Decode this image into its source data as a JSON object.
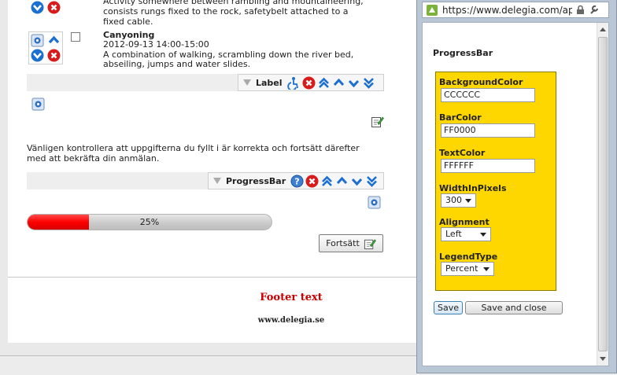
{
  "activities": [
    {
      "title": "",
      "lines": [
        "Activity somewhere between rambling and mountaineering,",
        "consists rungs fixed to the rock, safetybelt attached to a",
        "fixed cable."
      ]
    },
    {
      "title": "Canyoning",
      "lines": [
        "2012-09-13  14:00-15:00",
        "A combination of walking, scrambling down the river bed,",
        "abseiling, jumps and water slides."
      ]
    }
  ],
  "toolbars": {
    "label_toolbar": {
      "label": "Label"
    },
    "progressbar_toolbar": {
      "label": "ProgressBar"
    }
  },
  "instruction": {
    "line1": "Vänligen kontrollera att uppgifterna du fyllt i är korrekta och fortsätt därefter",
    "line2": "med att bekräfta din anmälan."
  },
  "progress": {
    "value_percent": 25,
    "text": "25%"
  },
  "continue_button": {
    "label": "Fortsätt"
  },
  "footer": {
    "text": "Footer text",
    "url": "www.delegia.se"
  },
  "popup": {
    "url": "https://www.delegia.com/app/a",
    "title": "ProgressBar",
    "fields": {
      "background_color": {
        "label": "BackgroundColor",
        "value": "CCCCCC"
      },
      "bar_color": {
        "label": "BarColor",
        "value": "FF0000"
      },
      "text_color": {
        "label": "TextColor",
        "value": "FFFFFF"
      },
      "width_in_pixels": {
        "label": "WidthInPixels",
        "value": "300"
      },
      "alignment": {
        "label": "Alignment",
        "value": "Left"
      },
      "legend_type": {
        "label": "LegendType",
        "value": "Percent"
      }
    },
    "save_label": "Save",
    "save_close_label": "Save and close"
  },
  "colors": {
    "accent_red": "#ff0000",
    "panel_yellow": "#ffd700",
    "footer_red": "#cc0000",
    "icon_blue": "#1a6fd1"
  },
  "icons": [
    "arrow-down-icon",
    "delete-icon",
    "arrow-up-icon",
    "settings-icon",
    "accessibility-icon",
    "double-up-icon",
    "double-down-icon",
    "help-icon",
    "edit-icon",
    "checkbox",
    "lock-icon",
    "wrench-icon",
    "site-icon"
  ]
}
